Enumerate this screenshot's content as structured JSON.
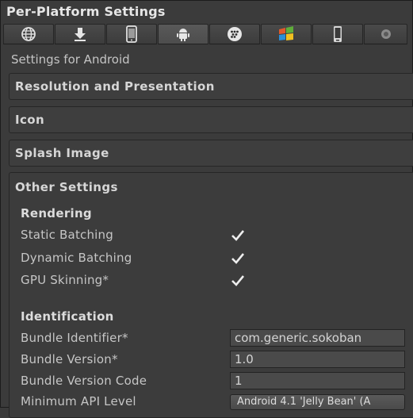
{
  "window": {
    "title": "Per-Platform Settings"
  },
  "platform_tabs": [
    {
      "icon": "globe-icon"
    },
    {
      "icon": "download-icon"
    },
    {
      "icon": "ios-device-icon"
    },
    {
      "icon": "android-icon",
      "active": true
    },
    {
      "icon": "blackberry-icon"
    },
    {
      "icon": "windows-flag-icon"
    },
    {
      "icon": "phone-icon"
    },
    {
      "icon": "console-disc-icon"
    }
  ],
  "settings_for": "Settings for Android",
  "sections": {
    "resolution": "Resolution and Presentation",
    "icon": "Icon",
    "splash": "Splash Image",
    "other": "Other Settings"
  },
  "rendering": {
    "heading": "Rendering",
    "static_batching": {
      "label": "Static Batching",
      "checked": true
    },
    "dynamic_batching": {
      "label": "Dynamic Batching",
      "checked": true
    },
    "gpu_skinning": {
      "label": "GPU Skinning*",
      "checked": true
    }
  },
  "identification": {
    "heading": "Identification",
    "bundle_identifier": {
      "label": "Bundle Identifier*",
      "value": "com.generic.sokoban"
    },
    "bundle_version": {
      "label": "Bundle Version*",
      "value": "1.0"
    },
    "bundle_version_code": {
      "label": "Bundle Version Code",
      "value": "1"
    },
    "min_api_level": {
      "label": "Minimum API Level",
      "value": "Android 4.1 'Jelly Bean' (A"
    }
  }
}
